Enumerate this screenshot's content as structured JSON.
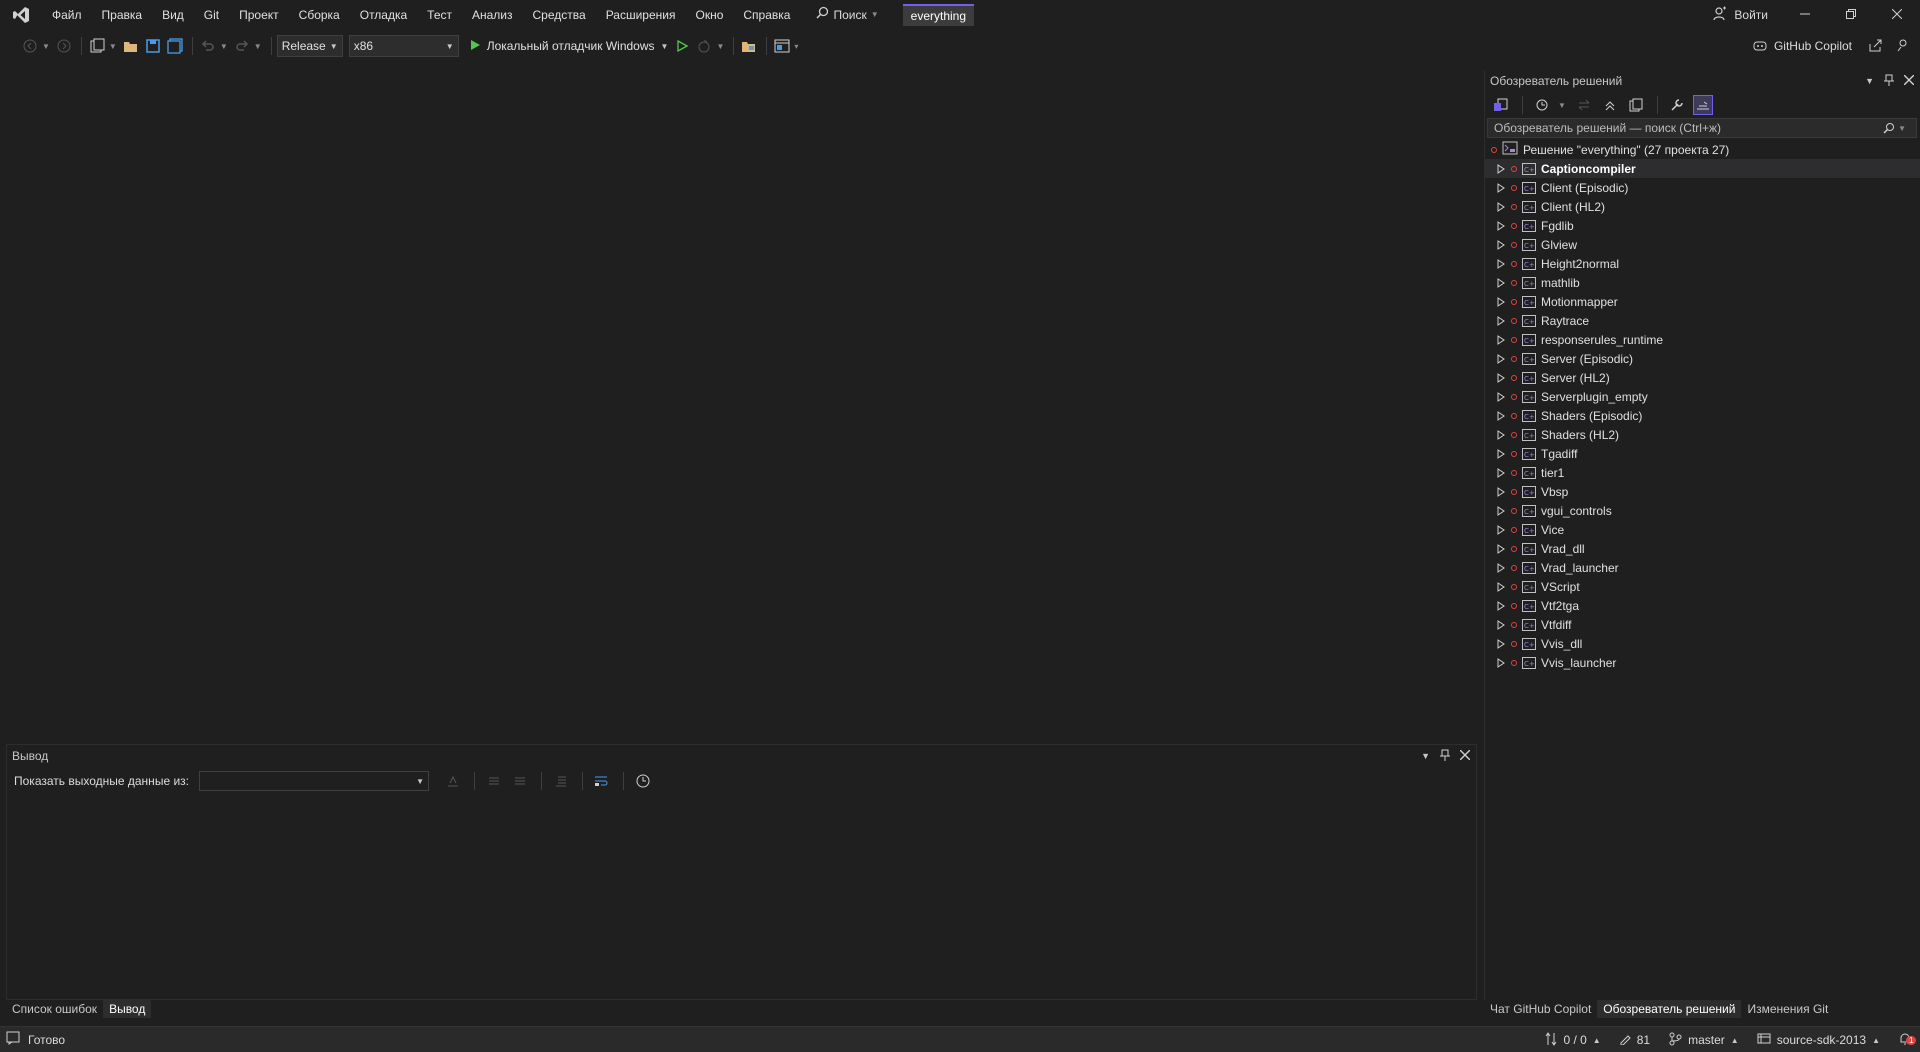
{
  "menubar": {
    "items": [
      "Файл",
      "Правка",
      "Вид",
      "Git",
      "Проект",
      "Сборка",
      "Отладка",
      "Тест",
      "Анализ",
      "Средства",
      "Расширения",
      "Окно",
      "Справка"
    ],
    "search_label": "Поиск",
    "solution_name": "everything",
    "signin_label": "Войти"
  },
  "toolbar": {
    "configuration": "Release",
    "platform": "x86",
    "run_label": "Локальный отладчик Windows",
    "copilot_label": "GitHub Copilot"
  },
  "solution_explorer": {
    "title": "Обозреватель решений",
    "search_placeholder": "Обозреватель решений — поиск (Ctrl+ж)",
    "root_label": "Решение \"everything\"  (27 проекта 27)",
    "projects": [
      "Captioncompiler",
      "Client (Episodic)",
      "Client (HL2)",
      "Fgdlib",
      "Glview",
      "Height2normal",
      "mathlib",
      "Motionmapper",
      "Raytrace",
      "responserules_runtime",
      "Server (Episodic)",
      "Server (HL2)",
      "Serverplugin_empty",
      "Shaders (Episodic)",
      "Shaders (HL2)",
      "Tgadiff",
      "tier1",
      "Vbsp",
      "vgui_controls",
      "Vice",
      "Vrad_dll",
      "Vrad_launcher",
      "VScript",
      "Vtf2tga",
      "Vtfdiff",
      "Vvis_dll",
      "Vvis_launcher"
    ],
    "selected_project": "Captioncompiler"
  },
  "output_panel": {
    "title": "Вывод",
    "show_from_label": "Показать выходные данные из:",
    "show_from_value": ""
  },
  "bottom_tabs": [
    "Список ошибок",
    "Вывод"
  ],
  "bottom_active_tab": "Вывод",
  "right_tabs": [
    "Чат GitHub Copilot",
    "Обозреватель решений",
    "Изменения Git"
  ],
  "right_active_tab": "Обозреватель решений",
  "statusbar": {
    "ready": "Готово",
    "sync": "0 / 0",
    "changes": "81",
    "branch": "master",
    "repo": "source-sdk-2013",
    "notifications": "1"
  },
  "colors": {
    "background": "#1f1f1f",
    "accent": "#7160e8",
    "error": "#e0443e",
    "run_green": "#4ec94e"
  }
}
